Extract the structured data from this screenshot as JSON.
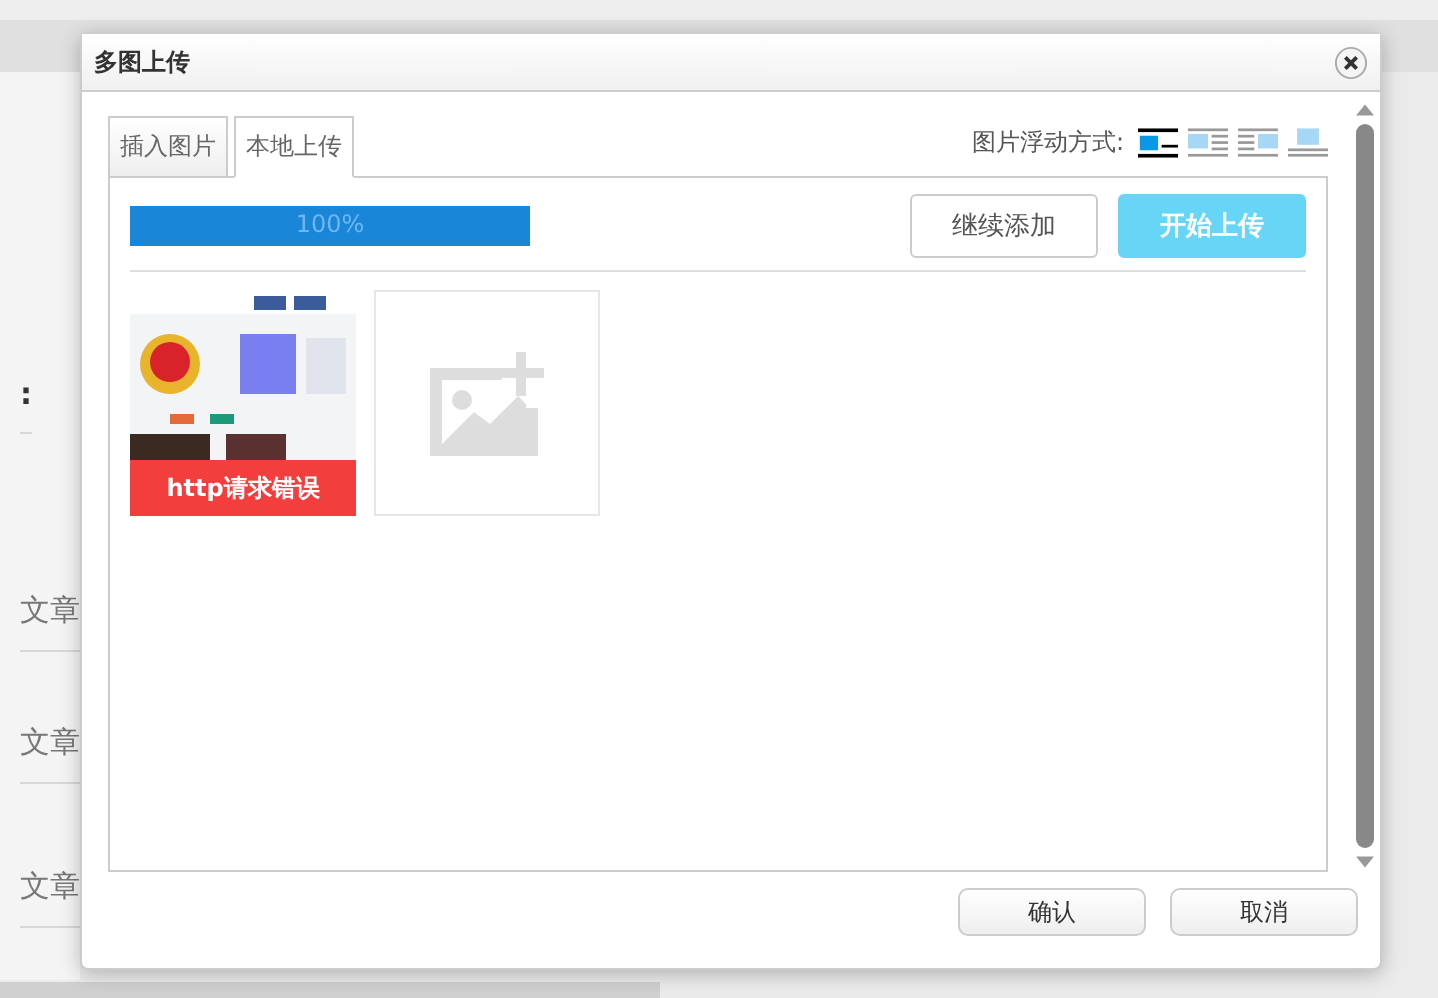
{
  "background": {
    "fragments": [
      ":",
      "文章",
      "文章",
      "文章"
    ]
  },
  "dialog": {
    "title": "多图上传",
    "tabs": [
      {
        "label": "插入图片",
        "selected": false
      },
      {
        "label": "本地上传",
        "selected": true
      }
    ],
    "float_label": "图片浮动方式:",
    "float_options": [
      {
        "kind": "none",
        "selected": true
      },
      {
        "kind": "left",
        "selected": false
      },
      {
        "kind": "right",
        "selected": false
      },
      {
        "kind": "center",
        "selected": false
      }
    ],
    "progress": {
      "level": 1,
      "text": "100%"
    },
    "toolbar_buttons": [
      {
        "label": "继续添加",
        "kind": "secondary"
      },
      {
        "label": "开始上传",
        "kind": "primary"
      }
    ],
    "files": [
      {
        "kind": "picture",
        "error": "http请求错误"
      },
      {
        "kind": "add"
      }
    ],
    "footer_buttons": [
      "确认",
      "取消"
    ]
  }
}
